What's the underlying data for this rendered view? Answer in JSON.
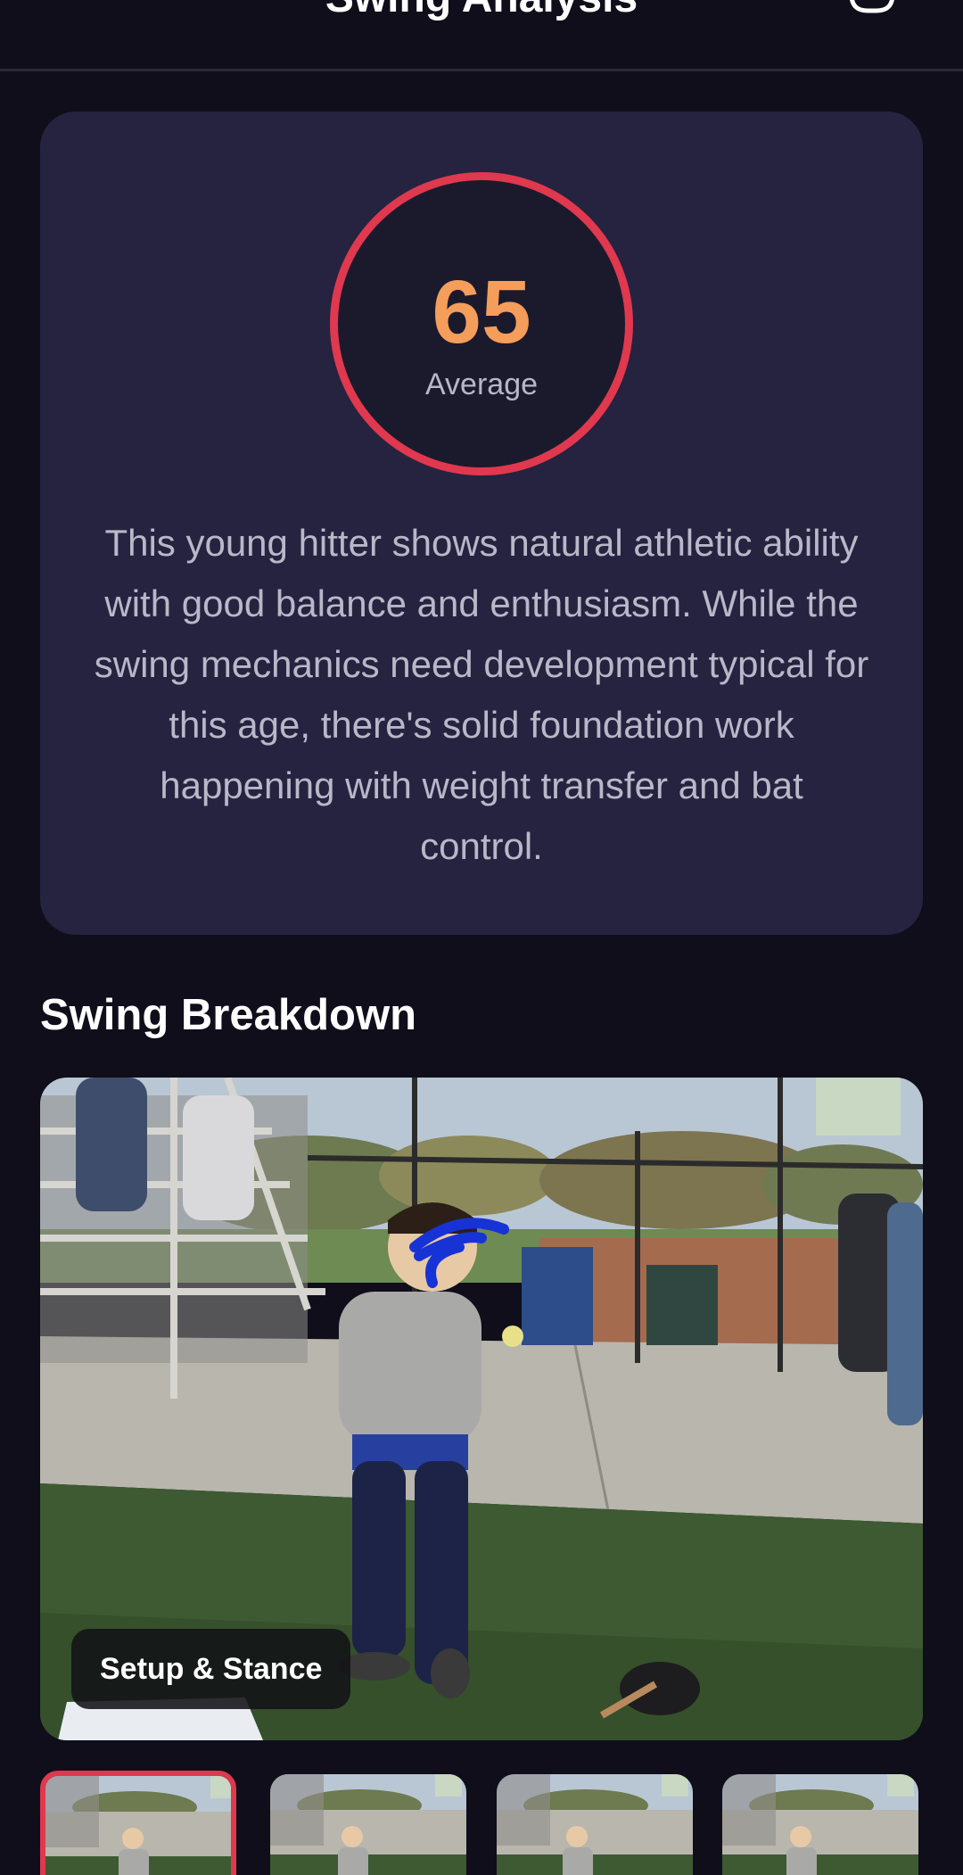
{
  "header": {
    "title": "Swing Analysis",
    "close_icon": "close-icon",
    "save_icon": "square-icon"
  },
  "score": {
    "value": "65",
    "label": "Average",
    "ring_color": "#e0384e",
    "value_color": "#f59d5a"
  },
  "summary": "This young hitter shows natural athletic ability with good balance and enthusiasm. While the swing mechanics need development typical for this age, there's solid foundation work happening with weight transfer and bat control.",
  "breakdown": {
    "title": "Swing Breakdown",
    "current_frame_label": "Setup & Stance",
    "thumbnails": [
      {
        "name": "frame-1",
        "selected": true
      },
      {
        "name": "frame-2",
        "selected": false
      },
      {
        "name": "frame-3",
        "selected": false
      },
      {
        "name": "frame-4",
        "selected": false
      }
    ]
  },
  "colors": {
    "background": "#0f0e1a",
    "card": "#25233f",
    "accent": "#e0384e"
  }
}
